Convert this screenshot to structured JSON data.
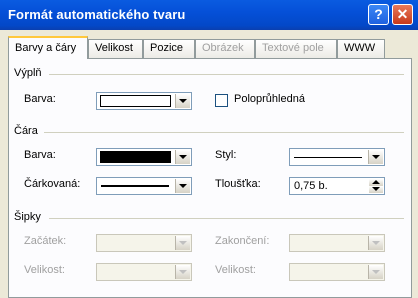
{
  "window": {
    "title": "Formát automatického tvaru",
    "help_glyph": "?",
    "close_glyph": "✕"
  },
  "tabs": [
    {
      "label": "Barvy a čáry",
      "state": "active"
    },
    {
      "label": "Velikost",
      "state": "enabled"
    },
    {
      "label": "Pozice",
      "state": "enabled"
    },
    {
      "label": "Obrázek",
      "state": "disabled"
    },
    {
      "label": "Textové pole",
      "state": "disabled"
    },
    {
      "label": "WWW",
      "state": "enabled"
    }
  ],
  "fill": {
    "section_label": "Výplň",
    "color_label": "Barva:",
    "color_value": "#FFFFFF",
    "semitransparent_label": "Poloprůhledná",
    "semitransparent_checked": false
  },
  "line": {
    "section_label": "Čára",
    "color_label": "Barva:",
    "color_value": "#000000",
    "style_label": "Styl:",
    "dashed_label": "Čárkovaná:",
    "weight_label": "Tloušťka:",
    "weight_value": "0,75 b."
  },
  "arrows": {
    "section_label": "Šipky",
    "begin_style_label": "Začátek:",
    "begin_size_label": "Velikost:",
    "end_style_label": "Zakončení:",
    "end_size_label": "Velikost:"
  }
}
